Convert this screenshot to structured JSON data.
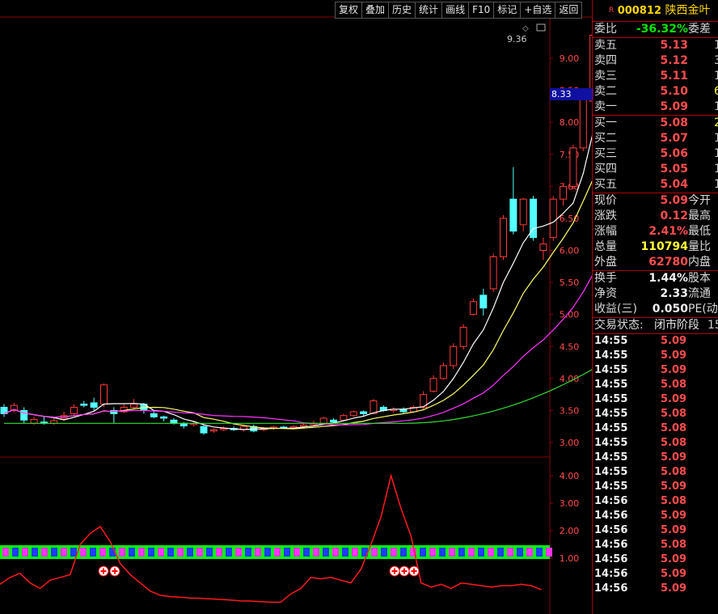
{
  "toolbar": {
    "buttons": [
      "复权",
      "叠加",
      "历史",
      "统计",
      "画线",
      "F10",
      "标记",
      "+自选",
      "返回"
    ]
  },
  "chart": {
    "price_axis": [
      "9.00",
      "8.50",
      "8.00",
      "7.50",
      "7.00",
      "6.50",
      "6.00",
      "5.50",
      "5.00",
      "4.50",
      "4.00",
      "3.50",
      "3.00"
    ],
    "indicator_axis": [
      "4.00",
      "3.00",
      "2.00",
      "1.00"
    ],
    "high_label": "9.36",
    "current_price_tag": "8.33",
    "colors": {
      "up": "#ff3b3b",
      "down": "#54ffff",
      "ma5": "#ffffff",
      "ma10": "#ffff66",
      "ma20": "#ff33ff",
      "ma60": "#33dd33",
      "indicator": "#ff1a1a"
    }
  },
  "quote": {
    "tag": "R",
    "code": "000812",
    "name": "陕西金叶",
    "weibi": {
      "label": "委比",
      "value": "-36.32%",
      "label2": "委差"
    },
    "sell": [
      {
        "label": "卖五",
        "price": "5.13",
        "vol": "1"
      },
      {
        "label": "卖四",
        "price": "5.12",
        "vol": "3"
      },
      {
        "label": "卖三",
        "price": "5.11",
        "vol": "1"
      },
      {
        "label": "卖二",
        "price": "5.10",
        "vol": "6"
      },
      {
        "label": "卖一",
        "price": "5.09",
        "vol": "1"
      }
    ],
    "buy": [
      {
        "label": "买一",
        "price": "5.08",
        "vol": "2"
      },
      {
        "label": "买二",
        "price": "5.07",
        "vol": "1"
      },
      {
        "label": "买三",
        "price": "5.06",
        "vol": "1"
      },
      {
        "label": "买四",
        "price": "5.05",
        "vol": "1"
      },
      {
        "label": "买五",
        "price": "5.04",
        "vol": "1"
      }
    ],
    "stats1": [
      {
        "label": "现价",
        "value": "5.09",
        "label2": "今开",
        "color": "red"
      },
      {
        "label": "涨跌",
        "value": "0.12",
        "label2": "最高",
        "color": "red"
      },
      {
        "label": "涨幅",
        "value": "2.41%",
        "label2": "最低",
        "color": "red"
      },
      {
        "label": "总量",
        "value": "110794",
        "label2": "量比",
        "color": "yellow"
      },
      {
        "label": "外盘",
        "value": "62780",
        "label2": "内盘",
        "color": "red"
      }
    ],
    "stats2": [
      {
        "label": "换手",
        "value": "1.44%",
        "label2": "股本",
        "color": "white"
      },
      {
        "label": "净资",
        "value": "2.33",
        "label2": "流通",
        "color": "white"
      },
      {
        "label": "收益(三)",
        "value": "0.050",
        "label2": "PE(动",
        "color": "white"
      }
    ],
    "status": {
      "label": "交易状态:",
      "value": "闭市阶段",
      "extra": "15"
    },
    "trades": [
      {
        "time": "14:55",
        "price": "5.09",
        "color": "red"
      },
      {
        "time": "14:55",
        "price": "5.09",
        "color": "red"
      },
      {
        "time": "14:55",
        "price": "5.09",
        "color": "red"
      },
      {
        "time": "14:55",
        "price": "5.08",
        "color": "red"
      },
      {
        "time": "14:55",
        "price": "5.09",
        "color": "red"
      },
      {
        "time": "14:55",
        "price": "5.08",
        "color": "red"
      },
      {
        "time": "14:55",
        "price": "5.08",
        "color": "red"
      },
      {
        "time": "14:55",
        "price": "5.08",
        "color": "red"
      },
      {
        "time": "14:55",
        "price": "5.09",
        "color": "red"
      },
      {
        "time": "14:55",
        "price": "5.08",
        "color": "red"
      },
      {
        "time": "14:55",
        "price": "5.09",
        "color": "red"
      },
      {
        "time": "14:56",
        "price": "5.08",
        "color": "red"
      },
      {
        "time": "14:56",
        "price": "5.09",
        "color": "red"
      },
      {
        "time": "14:56",
        "price": "5.09",
        "color": "red"
      },
      {
        "time": "14:56",
        "price": "5.08",
        "color": "red"
      },
      {
        "time": "14:56",
        "price": "5.09",
        "color": "red"
      },
      {
        "time": "14:56",
        "price": "5.09",
        "color": "red"
      },
      {
        "time": "14:56",
        "price": "5.09",
        "color": "red"
      }
    ]
  }
}
